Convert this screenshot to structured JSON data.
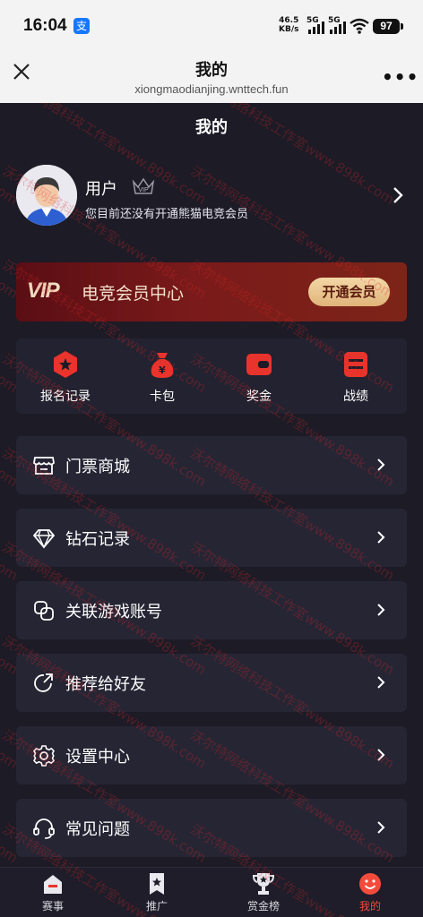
{
  "status_bar": {
    "time": "16:04",
    "alipay_glyph": "支",
    "net_speed": "46.5",
    "net_unit": "KB/s",
    "sig1": "5G",
    "sig2": "5G",
    "battery": "97"
  },
  "browser": {
    "title": "我的",
    "url": "xiongmaodianjing.wnttech.fun",
    "close_icon": "close-icon",
    "more_icon": "more-icon"
  },
  "page": {
    "title": "我的"
  },
  "profile": {
    "name": "用户",
    "subtitle": "您目前还没有开通熊猫电竞会员",
    "badge": "VIP"
  },
  "vip_card": {
    "logo": "VIP",
    "title": "电竞会员中心",
    "button": "开通会员"
  },
  "quick_actions": [
    {
      "label": "报名记录",
      "icon": "star-badge-icon"
    },
    {
      "label": "卡包",
      "icon": "money-bag-icon"
    },
    {
      "label": "奖金",
      "icon": "wallet-icon"
    },
    {
      "label": "战绩",
      "icon": "record-icon"
    }
  ],
  "menu": [
    {
      "label": "门票商城",
      "icon": "store-icon"
    },
    {
      "label": "钻石记录",
      "icon": "diamond-icon"
    },
    {
      "label": "关联游戏账号",
      "icon": "link-icon"
    },
    {
      "label": "推荐给好友",
      "icon": "share-icon"
    },
    {
      "label": "设置中心",
      "icon": "gear-icon"
    },
    {
      "label": "常见问题",
      "icon": "headset-icon"
    }
  ],
  "tabs": [
    {
      "label": "赛事",
      "icon": "trophy-cup-icon"
    },
    {
      "label": "推广",
      "icon": "bookmark-icon"
    },
    {
      "label": "赏金榜",
      "icon": "trophy-icon"
    },
    {
      "label": "我的",
      "icon": "smile-icon",
      "active": true
    }
  ],
  "watermark": "沃尔特网络科技工作室www.898k.com",
  "colors": {
    "background": "#1c1b26",
    "accent_red": "#e8342c",
    "vip_gold": "#e6bd84",
    "active_tab": "#f24b3c"
  }
}
